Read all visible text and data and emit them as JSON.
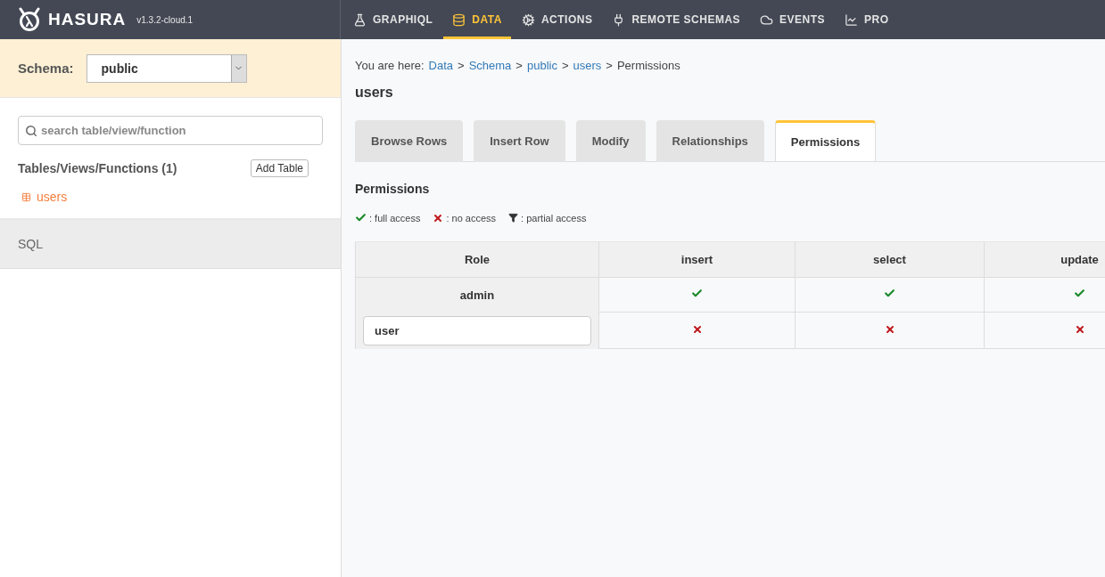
{
  "brand": {
    "name": "HASURA",
    "version": "v1.3.2-cloud.1"
  },
  "nav": [
    {
      "label": "GRAPHIQL",
      "selected": false
    },
    {
      "label": "DATA",
      "selected": true
    },
    {
      "label": "ACTIONS",
      "selected": false
    },
    {
      "label": "REMOTE SCHEMAS",
      "selected": false
    },
    {
      "label": "EVENTS",
      "selected": false
    },
    {
      "label": "PRO",
      "selected": false
    }
  ],
  "sidebar": {
    "schema_label": "Schema:",
    "schema_value": "public",
    "search_placeholder": "search table/view/function",
    "tables_heading": "Tables/Views/Functions (1)",
    "add_button": "Add Table",
    "tables": [
      {
        "name": "users",
        "selected": true
      }
    ],
    "sql_link": "SQL"
  },
  "breadcrumb": {
    "prefix": "You are here:",
    "separator": ">",
    "links": [
      "Data",
      "Schema",
      "public",
      "users"
    ],
    "current": "Permissions"
  },
  "title": "users",
  "tabs": [
    {
      "label": "Browse Rows",
      "selected": false
    },
    {
      "label": "Insert Row",
      "selected": false
    },
    {
      "label": "Modify",
      "selected": false
    },
    {
      "label": "Relationships",
      "selected": false
    },
    {
      "label": "Permissions",
      "selected": true
    }
  ],
  "section_title": "Permissions",
  "legend": [
    {
      "kind": "full",
      "label": ": full access"
    },
    {
      "kind": "none",
      "label": ": no access"
    },
    {
      "kind": "partial",
      "label": ": partial access"
    }
  ],
  "table": {
    "role_header": "Role",
    "columns": [
      "insert",
      "select",
      "update"
    ],
    "rows": [
      {
        "role": "admin",
        "editable": false,
        "access": [
          {
            "kind": "full"
          },
          {
            "kind": "full"
          },
          {
            "kind": "full"
          }
        ]
      },
      {
        "role": "user",
        "editable": true,
        "access": [
          {
            "kind": "none"
          },
          {
            "kind": "none"
          },
          {
            "kind": "none"
          }
        ]
      }
    ]
  }
}
